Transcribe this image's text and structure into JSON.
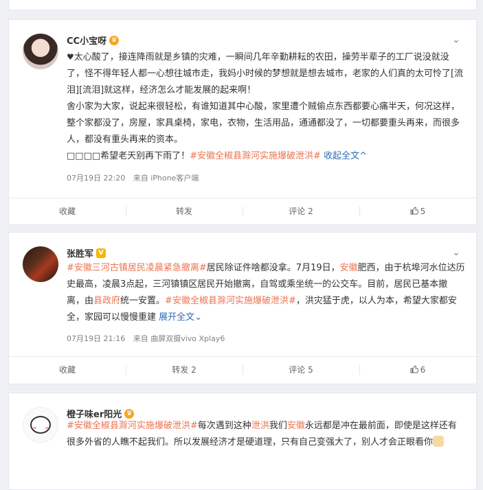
{
  "top": {
    "actions": [
      "",
      "",
      "",
      ""
    ]
  },
  "posts": [
    {
      "username": "CC小宝呀",
      "badge": "crown",
      "paragraphs": [
        "太心酸了，接连降雨就是乡镇的灾难，一瞬间几年辛勤耕耘的农田，操劳半辈子的工厂说没就没了，怪不得年轻人都一心想往城市走，我妈小时候的梦想就是想去城市，老家的人们真的太可怜了[流泪][流泪]就这样，经济怎么才能发展的起来啊！",
        "舍小家为大家，说起来很轻松，有谁知道其中心酸，家里遭个贼偷点东西都要心痛半天，何况这样，整个家都没了，房屋，家具桌椅，家电，衣物，生活用品，通通都没了，一切都要重头再来，而很多人，都没有重头再来的资本。"
      ],
      "last_line_prefix": "□□□□希望老天别再下雨了！",
      "last_line_topic": "#安徽全椒县滁河实施爆破泄洪#",
      "collapse_label": "收起全文",
      "time": "07月19日 22:20",
      "source": "来自 iPhone客户端",
      "actions": {
        "fav": "收藏",
        "repost": "转发",
        "comment": "评论 2",
        "like": "5"
      }
    },
    {
      "username": "张胜军",
      "badge": "v",
      "text_parts": [
        {
          "t": "#安徽三河古镇居民凌晨紧急撤离#",
          "c": "link"
        },
        {
          "t": "居民除证件啥都没拿。7月19日，",
          "c": ""
        },
        {
          "t": "安徽",
          "c": "link"
        },
        {
          "t": "肥西，由于杭埠河水位达历史最高，凌晨3点起，三河镇镇区居民开始撤离，自驾或乘坐统一的公交车。目前，居民已基本撤离，由",
          "c": ""
        },
        {
          "t": "县政府",
          "c": "link"
        },
        {
          "t": "统一安置。",
          "c": ""
        },
        {
          "t": "#安徽全椒县滁河实施爆破泄洪#",
          "c": "link"
        },
        {
          "t": "，洪灾猛于虎，以人为本，希望大家都安全，家园可以慢慢重建 ",
          "c": ""
        },
        {
          "t": "展开全文",
          "c": "blue"
        }
      ],
      "time": "07月19日 21:16",
      "source": "来自 曲屏双摄vivo Xplay6",
      "actions": {
        "fav": "收藏",
        "repost": "转发 2",
        "comment": "评论 5",
        "like": "6"
      }
    },
    {
      "username": "橙子味er阳光",
      "badge": "crown",
      "text_parts": [
        {
          "t": "#安徽全椒县滁河实施爆破泄洪#",
          "c": "link"
        },
        {
          "t": "每次遇到这种",
          "c": ""
        },
        {
          "t": "泄洪",
          "c": "link"
        },
        {
          "t": "我们",
          "c": ""
        },
        {
          "t": "安徽",
          "c": "link"
        },
        {
          "t": "永远都是冲在最前面，即使是这样还有很多外省的人瞧不起我们。所以发展经济才是硬道理，只有自己变强大了，别人才会正眼看你",
          "c": ""
        }
      ]
    }
  ],
  "colors": {
    "topic": "#eb7350",
    "blue_link": "#2e6cb3",
    "meta": "#808080"
  },
  "icons": [
    "chevron-down-icon",
    "heart-icon",
    "thumb-up-icon",
    "crown-icon",
    "verified-icon"
  ]
}
